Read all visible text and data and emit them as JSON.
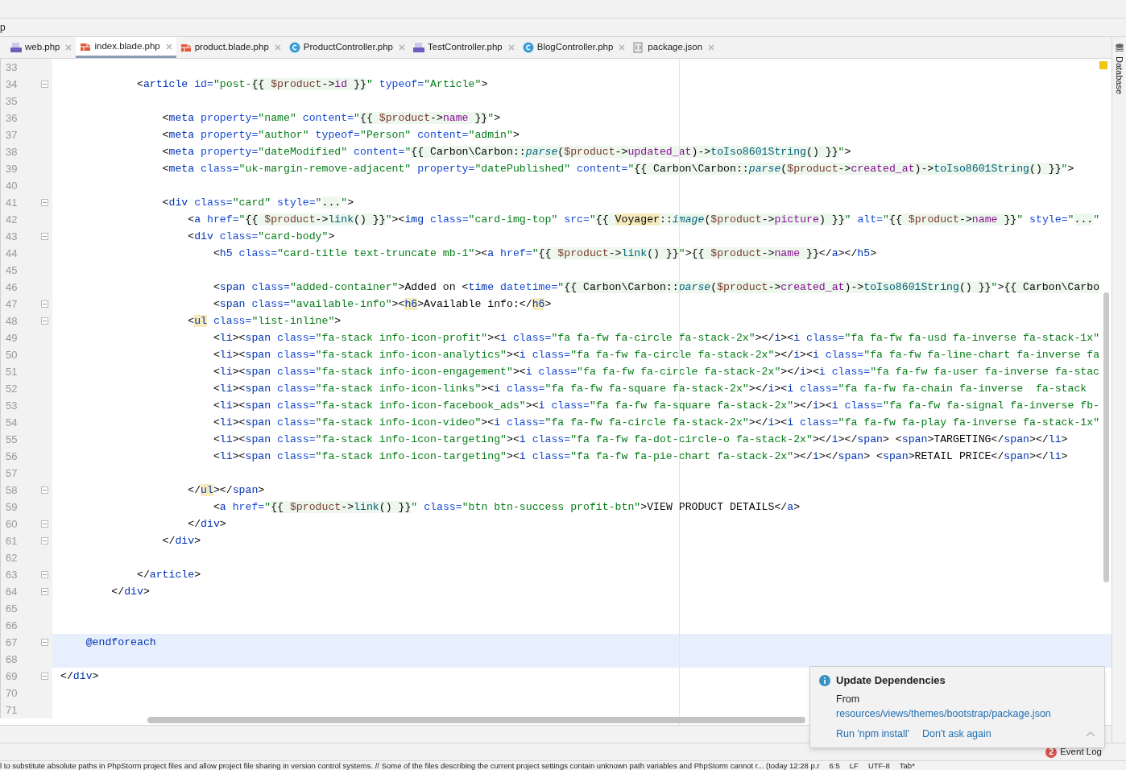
{
  "breadcrumb": "p",
  "tabs": [
    {
      "label": "web.php",
      "kind": "php",
      "selected": false
    },
    {
      "label": "index.blade.php",
      "kind": "blade",
      "selected": true
    },
    {
      "label": "product.blade.php",
      "kind": "blade",
      "selected": false
    },
    {
      "label": "ProductController.php",
      "kind": "class",
      "selected": false
    },
    {
      "label": "TestController.php",
      "kind": "php",
      "selected": false
    },
    {
      "label": "BlogController.php",
      "kind": "class",
      "selected": false
    },
    {
      "label": "package.json",
      "kind": "json",
      "selected": false
    }
  ],
  "side_panel": {
    "label": "Database"
  },
  "editor": {
    "lines": [
      {
        "number": "33",
        "fold": false,
        "current": false
      },
      {
        "number": "34",
        "fold": true,
        "current": false,
        "tokens": [
          {
            "kind": "p",
            "text": "            <"
          },
          {
            "kind": "tag",
            "text": "article"
          },
          {
            "kind": "attr",
            "text": " id="
          },
          {
            "kind": "str",
            "text": "\"post-"
          },
          {
            "kind": "b",
            "text": "{{ "
          },
          {
            "kind": "bv",
            "text": "$product"
          },
          {
            "kind": "b",
            "text": "->"
          },
          {
            "kind": "bp",
            "text": "id"
          },
          {
            "kind": "b",
            "text": " }}"
          },
          {
            "kind": "str",
            "text": "\""
          },
          {
            "kind": "attr",
            "text": " typeof="
          },
          {
            "kind": "str",
            "text": "\"Article\""
          },
          {
            "kind": "p",
            "text": ">"
          }
        ]
      },
      {
        "number": "35",
        "fold": false,
        "current": false
      },
      {
        "number": "36",
        "fold": false,
        "current": false,
        "tokens": [
          {
            "kind": "p",
            "text": "                <"
          },
          {
            "kind": "tag",
            "text": "meta"
          },
          {
            "kind": "attr",
            "text": " property="
          },
          {
            "kind": "str",
            "text": "\"name\""
          },
          {
            "kind": "attr",
            "text": " content="
          },
          {
            "kind": "str",
            "text": "\""
          },
          {
            "kind": "b",
            "text": "{{ "
          },
          {
            "kind": "bv",
            "text": "$product"
          },
          {
            "kind": "b",
            "text": "->"
          },
          {
            "kind": "bp",
            "text": "name"
          },
          {
            "kind": "b",
            "text": " }}"
          },
          {
            "kind": "str",
            "text": "\""
          },
          {
            "kind": "p",
            "text": ">"
          }
        ]
      },
      {
        "number": "37",
        "fold": false,
        "current": false,
        "tokens": [
          {
            "kind": "p",
            "text": "                <"
          },
          {
            "kind": "tag",
            "text": "meta"
          },
          {
            "kind": "attr",
            "text": " property="
          },
          {
            "kind": "str",
            "text": "\"author\""
          },
          {
            "kind": "attr",
            "text": " typeof="
          },
          {
            "kind": "str",
            "text": "\"Person\""
          },
          {
            "kind": "attr",
            "text": " content="
          },
          {
            "kind": "str",
            "text": "\"admin\""
          },
          {
            "kind": "p",
            "text": ">"
          }
        ]
      },
      {
        "number": "38",
        "fold": false,
        "current": false,
        "tokens": [
          {
            "kind": "p",
            "text": "                <"
          },
          {
            "kind": "tag",
            "text": "meta"
          },
          {
            "kind": "attr",
            "text": " property="
          },
          {
            "kind": "str",
            "text": "\"dateModified\""
          },
          {
            "kind": "attr",
            "text": " content="
          },
          {
            "kind": "str",
            "text": "\""
          },
          {
            "kind": "b",
            "text": "{{ Carbon\\Carbon::"
          },
          {
            "kind": "bf",
            "text": "parse"
          },
          {
            "kind": "b",
            "text": "("
          },
          {
            "kind": "bv",
            "text": "$product"
          },
          {
            "kind": "b",
            "text": "->"
          },
          {
            "kind": "bp",
            "text": "updated_at"
          },
          {
            "kind": "b",
            "text": ")->"
          },
          {
            "kind": "bm",
            "text": "toIso8601String"
          },
          {
            "kind": "b",
            "text": "() }}"
          },
          {
            "kind": "str",
            "text": "\""
          },
          {
            "kind": "p",
            "text": ">"
          }
        ]
      },
      {
        "number": "39",
        "fold": false,
        "current": false,
        "tokens": [
          {
            "kind": "p",
            "text": "                <"
          },
          {
            "kind": "tag",
            "text": "meta"
          },
          {
            "kind": "attr",
            "text": " class="
          },
          {
            "kind": "str",
            "text": "\"uk-margin-remove-adjacent\""
          },
          {
            "kind": "attr",
            "text": " property="
          },
          {
            "kind": "str",
            "text": "\"datePublished\""
          },
          {
            "kind": "attr",
            "text": " content="
          },
          {
            "kind": "str",
            "text": "\""
          },
          {
            "kind": "b",
            "text": "{{ Carbon\\Carbon::"
          },
          {
            "kind": "bf",
            "text": "parse"
          },
          {
            "kind": "b",
            "text": "("
          },
          {
            "kind": "bv",
            "text": "$product"
          },
          {
            "kind": "b",
            "text": "->"
          },
          {
            "kind": "bp",
            "text": "created_at"
          },
          {
            "kind": "b",
            "text": ")->"
          },
          {
            "kind": "bm",
            "text": "toIso8601String"
          },
          {
            "kind": "b",
            "text": "() }}"
          },
          {
            "kind": "str",
            "text": "\""
          },
          {
            "kind": "p",
            "text": ">"
          }
        ]
      },
      {
        "number": "40",
        "fold": false,
        "current": false
      },
      {
        "number": "41",
        "fold": true,
        "current": false,
        "tokens": [
          {
            "kind": "p",
            "text": "                <"
          },
          {
            "kind": "tag",
            "text": "div"
          },
          {
            "kind": "attr",
            "text": " class="
          },
          {
            "kind": "str",
            "text": "\"card\""
          },
          {
            "kind": "attr",
            "text": " style="
          },
          {
            "kind": "str",
            "text": "\""
          },
          {
            "kind": "b",
            "text": "..."
          },
          {
            "kind": "str",
            "text": "\""
          },
          {
            "kind": "p",
            "text": ">"
          }
        ]
      },
      {
        "number": "42",
        "fold": false,
        "current": false,
        "tokens": [
          {
            "kind": "p",
            "text": "                    <"
          },
          {
            "kind": "tag",
            "text": "a"
          },
          {
            "kind": "attr",
            "text": " href="
          },
          {
            "kind": "str",
            "text": "\""
          },
          {
            "kind": "b",
            "text": "{{ "
          },
          {
            "kind": "bv",
            "text": "$product"
          },
          {
            "kind": "b",
            "text": "->"
          },
          {
            "kind": "bm",
            "text": "link"
          },
          {
            "kind": "b",
            "text": "() }}"
          },
          {
            "kind": "str",
            "text": "\""
          },
          {
            "kind": "p",
            "text": "><"
          },
          {
            "kind": "tag",
            "text": "img"
          },
          {
            "kind": "attr",
            "text": " class="
          },
          {
            "kind": "str",
            "text": "\"card-img-top\""
          },
          {
            "kind": "attr",
            "text": " src="
          },
          {
            "kind": "str",
            "text": "\""
          },
          {
            "kind": "b",
            "text": "{{ "
          },
          {
            "kind": "bc",
            "text": "Voyager"
          },
          {
            "kind": "b",
            "text": "::"
          },
          {
            "kind": "bf",
            "text": "image"
          },
          {
            "kind": "b",
            "text": "("
          },
          {
            "kind": "bv",
            "text": "$product"
          },
          {
            "kind": "b",
            "text": "->"
          },
          {
            "kind": "bp",
            "text": "picture"
          },
          {
            "kind": "b",
            "text": ") }}"
          },
          {
            "kind": "str",
            "text": "\""
          },
          {
            "kind": "attr",
            "text": " alt="
          },
          {
            "kind": "str",
            "text": "\""
          },
          {
            "kind": "b",
            "text": "{{ "
          },
          {
            "kind": "bv",
            "text": "$product"
          },
          {
            "kind": "b",
            "text": "->"
          },
          {
            "kind": "bp",
            "text": "name"
          },
          {
            "kind": "b",
            "text": " }}"
          },
          {
            "kind": "str",
            "text": "\""
          },
          {
            "kind": "attr",
            "text": " style="
          },
          {
            "kind": "str",
            "text": "\""
          },
          {
            "kind": "b",
            "text": "..."
          },
          {
            "kind": "str",
            "text": "\""
          }
        ]
      },
      {
        "number": "43",
        "fold": true,
        "current": false,
        "tokens": [
          {
            "kind": "p",
            "text": "                    <"
          },
          {
            "kind": "tag",
            "text": "div"
          },
          {
            "kind": "attr",
            "text": " class="
          },
          {
            "kind": "str",
            "text": "\"card-body\""
          },
          {
            "kind": "p",
            "text": ">"
          }
        ]
      },
      {
        "number": "44",
        "fold": false,
        "current": false,
        "tokens": [
          {
            "kind": "p",
            "text": "                        <"
          },
          {
            "kind": "tag",
            "text": "h5"
          },
          {
            "kind": "attr",
            "text": " class="
          },
          {
            "kind": "str",
            "text": "\"card-title text-truncate mb-1\""
          },
          {
            "kind": "p",
            "text": "><"
          },
          {
            "kind": "tag",
            "text": "a"
          },
          {
            "kind": "attr",
            "text": " href="
          },
          {
            "kind": "str",
            "text": "\""
          },
          {
            "kind": "b",
            "text": "{{ "
          },
          {
            "kind": "bv",
            "text": "$product"
          },
          {
            "kind": "b",
            "text": "->"
          },
          {
            "kind": "bm",
            "text": "link"
          },
          {
            "kind": "b",
            "text": "() }}"
          },
          {
            "kind": "str",
            "text": "\""
          },
          {
            "kind": "p",
            "text": ">"
          },
          {
            "kind": "b",
            "text": "{{ "
          },
          {
            "kind": "bv",
            "text": "$product"
          },
          {
            "kind": "b",
            "text": "->"
          },
          {
            "kind": "bp",
            "text": "name"
          },
          {
            "kind": "b",
            "text": " }}"
          },
          {
            "kind": "p",
            "text": "</"
          },
          {
            "kind": "tag",
            "text": "a"
          },
          {
            "kind": "p",
            "text": "></"
          },
          {
            "kind": "tag",
            "text": "h5"
          },
          {
            "kind": "p",
            "text": ">"
          }
        ]
      },
      {
        "number": "45",
        "fold": false,
        "current": false
      },
      {
        "number": "46",
        "fold": false,
        "current": false,
        "tokens": [
          {
            "kind": "p",
            "text": "                        <"
          },
          {
            "kind": "tag",
            "text": "span"
          },
          {
            "kind": "attr",
            "text": " class="
          },
          {
            "kind": "str",
            "text": "\"added-container\""
          },
          {
            "kind": "p",
            "text": ">Added on <"
          },
          {
            "kind": "tag",
            "text": "time"
          },
          {
            "kind": "attr",
            "text": " datetime="
          },
          {
            "kind": "str",
            "text": "\""
          },
          {
            "kind": "b",
            "text": "{{ Carbon\\Carbon::"
          },
          {
            "kind": "bf",
            "text": "parse"
          },
          {
            "kind": "b",
            "text": "("
          },
          {
            "kind": "bv",
            "text": "$product"
          },
          {
            "kind": "b",
            "text": "->"
          },
          {
            "kind": "bp",
            "text": "created_at"
          },
          {
            "kind": "b",
            "text": ")->"
          },
          {
            "kind": "bm",
            "text": "toIso8601String"
          },
          {
            "kind": "b",
            "text": "() }}"
          },
          {
            "kind": "str",
            "text": "\""
          },
          {
            "kind": "p",
            "text": ">"
          },
          {
            "kind": "b",
            "text": "{{ Carbon\\Carbo"
          }
        ]
      },
      {
        "number": "47",
        "fold": true,
        "current": false,
        "tokens": [
          {
            "kind": "p",
            "text": "                        <"
          },
          {
            "kind": "tag",
            "text": "span"
          },
          {
            "kind": "attr",
            "text": " class="
          },
          {
            "kind": "str",
            "text": "\"available-info\""
          },
          {
            "kind": "p",
            "text": "><"
          },
          {
            "kind": "tm",
            "text": "h6"
          },
          {
            "kind": "p",
            "text": ">Available info:</"
          },
          {
            "kind": "tm",
            "text": "h6"
          },
          {
            "kind": "p",
            "text": ">"
          }
        ]
      },
      {
        "number": "48",
        "fold": true,
        "current": false,
        "tokens": [
          {
            "kind": "p",
            "text": "                    <"
          },
          {
            "kind": "tm",
            "text": "ul"
          },
          {
            "kind": "attr",
            "text": " class="
          },
          {
            "kind": "str",
            "text": "\"list-inline\""
          },
          {
            "kind": "p",
            "text": ">"
          }
        ]
      },
      {
        "number": "49",
        "fold": false,
        "current": false,
        "tokens": [
          {
            "kind": "p",
            "text": "                        <"
          },
          {
            "kind": "tag",
            "text": "li"
          },
          {
            "kind": "p",
            "text": "><"
          },
          {
            "kind": "tag",
            "text": "span"
          },
          {
            "kind": "attr",
            "text": " class="
          },
          {
            "kind": "str",
            "text": "\"fa-stack info-icon-profit\""
          },
          {
            "kind": "p",
            "text": "><"
          },
          {
            "kind": "tag",
            "text": "i"
          },
          {
            "kind": "attr",
            "text": " class="
          },
          {
            "kind": "str",
            "text": "\"fa fa-fw fa-circle fa-stack-2x\""
          },
          {
            "kind": "p",
            "text": "></"
          },
          {
            "kind": "tag",
            "text": "i"
          },
          {
            "kind": "p",
            "text": "><"
          },
          {
            "kind": "tag",
            "text": "i"
          },
          {
            "kind": "attr",
            "text": " class="
          },
          {
            "kind": "str",
            "text": "\"fa fa-fw fa-usd fa-inverse fa-stack-1x\""
          }
        ]
      },
      {
        "number": "50",
        "fold": false,
        "current": false,
        "tokens": [
          {
            "kind": "p",
            "text": "                        <"
          },
          {
            "kind": "tag",
            "text": "li"
          },
          {
            "kind": "p",
            "text": "><"
          },
          {
            "kind": "tag",
            "text": "span"
          },
          {
            "kind": "attr",
            "text": " class="
          },
          {
            "kind": "str",
            "text": "\"fa-stack info-icon-analytics\""
          },
          {
            "kind": "p",
            "text": "><"
          },
          {
            "kind": "tag",
            "text": "i"
          },
          {
            "kind": "attr",
            "text": " class="
          },
          {
            "kind": "str",
            "text": "\"fa fa-fw fa-circle fa-stack-2x\""
          },
          {
            "kind": "p",
            "text": "></"
          },
          {
            "kind": "tag",
            "text": "i"
          },
          {
            "kind": "p",
            "text": "><"
          },
          {
            "kind": "tag",
            "text": "i"
          },
          {
            "kind": "attr",
            "text": " class="
          },
          {
            "kind": "str",
            "text": "\"fa fa-fw fa-line-chart fa-inverse fa"
          }
        ]
      },
      {
        "number": "51",
        "fold": false,
        "current": false,
        "tokens": [
          {
            "kind": "p",
            "text": "                        <"
          },
          {
            "kind": "tag",
            "text": "li"
          },
          {
            "kind": "p",
            "text": "><"
          },
          {
            "kind": "tag",
            "text": "span"
          },
          {
            "kind": "attr",
            "text": " class="
          },
          {
            "kind": "str",
            "text": "\"fa-stack info-icon-engagement\""
          },
          {
            "kind": "p",
            "text": "><"
          },
          {
            "kind": "tag",
            "text": "i"
          },
          {
            "kind": "attr",
            "text": " class="
          },
          {
            "kind": "str",
            "text": "\"fa fa-fw fa-circle fa-stack-2x\""
          },
          {
            "kind": "p",
            "text": "></"
          },
          {
            "kind": "tag",
            "text": "i"
          },
          {
            "kind": "p",
            "text": "><"
          },
          {
            "kind": "tag",
            "text": "i"
          },
          {
            "kind": "attr",
            "text": " class="
          },
          {
            "kind": "str",
            "text": "\"fa fa-fw fa-user fa-inverse fa-stac"
          }
        ]
      },
      {
        "number": "52",
        "fold": false,
        "current": false,
        "tokens": [
          {
            "kind": "p",
            "text": "                        <"
          },
          {
            "kind": "tag",
            "text": "li"
          },
          {
            "kind": "p",
            "text": "><"
          },
          {
            "kind": "tag",
            "text": "span"
          },
          {
            "kind": "attr",
            "text": " class="
          },
          {
            "kind": "str",
            "text": "\"fa-stack info-icon-links\""
          },
          {
            "kind": "p",
            "text": "><"
          },
          {
            "kind": "tag",
            "text": "i"
          },
          {
            "kind": "attr",
            "text": " class="
          },
          {
            "kind": "str",
            "text": "\"fa fa-fw fa-square fa-stack-2x\""
          },
          {
            "kind": "p",
            "text": "></"
          },
          {
            "kind": "tag",
            "text": "i"
          },
          {
            "kind": "p",
            "text": "><"
          },
          {
            "kind": "tag",
            "text": "i"
          },
          {
            "kind": "attr",
            "text": " class="
          },
          {
            "kind": "str",
            "text": "\"fa fa-fw fa-chain fa-inverse  fa-stack"
          }
        ]
      },
      {
        "number": "53",
        "fold": false,
        "current": false,
        "tokens": [
          {
            "kind": "p",
            "text": "                        <"
          },
          {
            "kind": "tag",
            "text": "li"
          },
          {
            "kind": "p",
            "text": "><"
          },
          {
            "kind": "tag",
            "text": "span"
          },
          {
            "kind": "attr",
            "text": " class="
          },
          {
            "kind": "str",
            "text": "\"fa-stack info-icon-facebook_ads\""
          },
          {
            "kind": "p",
            "text": "><"
          },
          {
            "kind": "tag",
            "text": "i"
          },
          {
            "kind": "attr",
            "text": " class="
          },
          {
            "kind": "str",
            "text": "\"fa fa-fw fa-square fa-stack-2x\""
          },
          {
            "kind": "p",
            "text": "></"
          },
          {
            "kind": "tag",
            "text": "i"
          },
          {
            "kind": "p",
            "text": "><"
          },
          {
            "kind": "tag",
            "text": "i"
          },
          {
            "kind": "attr",
            "text": " class="
          },
          {
            "kind": "str",
            "text": "\"fa fa-fw fa-signal fa-inverse fb-"
          }
        ]
      },
      {
        "number": "54",
        "fold": false,
        "current": false,
        "tokens": [
          {
            "kind": "p",
            "text": "                        <"
          },
          {
            "kind": "tag",
            "text": "li"
          },
          {
            "kind": "p",
            "text": "><"
          },
          {
            "kind": "tag",
            "text": "span"
          },
          {
            "kind": "attr",
            "text": " class="
          },
          {
            "kind": "str",
            "text": "\"fa-stack info-icon-video\""
          },
          {
            "kind": "p",
            "text": "><"
          },
          {
            "kind": "tag",
            "text": "i"
          },
          {
            "kind": "attr",
            "text": " class="
          },
          {
            "kind": "str",
            "text": "\"fa fa-fw fa-circle fa-stack-2x\""
          },
          {
            "kind": "p",
            "text": "></"
          },
          {
            "kind": "tag",
            "text": "i"
          },
          {
            "kind": "p",
            "text": "><"
          },
          {
            "kind": "tag",
            "text": "i"
          },
          {
            "kind": "attr",
            "text": " class="
          },
          {
            "kind": "str",
            "text": "\"fa fa-fw fa-play fa-inverse fa-stack-1x\""
          }
        ]
      },
      {
        "number": "55",
        "fold": false,
        "current": false,
        "tokens": [
          {
            "kind": "p",
            "text": "                        <"
          },
          {
            "kind": "tag",
            "text": "li"
          },
          {
            "kind": "p",
            "text": "><"
          },
          {
            "kind": "tag",
            "text": "span"
          },
          {
            "kind": "attr",
            "text": " class="
          },
          {
            "kind": "str",
            "text": "\"fa-stack info-icon-targeting\""
          },
          {
            "kind": "p",
            "text": "><"
          },
          {
            "kind": "tag",
            "text": "i"
          },
          {
            "kind": "attr",
            "text": " class="
          },
          {
            "kind": "str",
            "text": "\"fa fa-fw fa-dot-circle-o fa-stack-2x\""
          },
          {
            "kind": "p",
            "text": "></"
          },
          {
            "kind": "tag",
            "text": "i"
          },
          {
            "kind": "p",
            "text": "></"
          },
          {
            "kind": "tag",
            "text": "span"
          },
          {
            "kind": "p",
            "text": "> <"
          },
          {
            "kind": "tag",
            "text": "span"
          },
          {
            "kind": "p",
            "text": ">TARGETING</"
          },
          {
            "kind": "tag",
            "text": "span"
          },
          {
            "kind": "p",
            "text": "></"
          },
          {
            "kind": "tag",
            "text": "li"
          },
          {
            "kind": "p",
            "text": ">"
          }
        ]
      },
      {
        "number": "56",
        "fold": false,
        "current": false,
        "tokens": [
          {
            "kind": "p",
            "text": "                        <"
          },
          {
            "kind": "tag",
            "text": "li"
          },
          {
            "kind": "p",
            "text": "><"
          },
          {
            "kind": "tag",
            "text": "span"
          },
          {
            "kind": "attr",
            "text": " class="
          },
          {
            "kind": "str",
            "text": "\"fa-stack info-icon-targeting\""
          },
          {
            "kind": "p",
            "text": "><"
          },
          {
            "kind": "tag",
            "text": "i"
          },
          {
            "kind": "attr",
            "text": " class="
          },
          {
            "kind": "str",
            "text": "\"fa fa-fw fa-pie-chart fa-stack-2x\""
          },
          {
            "kind": "p",
            "text": "></"
          },
          {
            "kind": "tag",
            "text": "i"
          },
          {
            "kind": "p",
            "text": "></"
          },
          {
            "kind": "tag",
            "text": "span"
          },
          {
            "kind": "p",
            "text": "> <"
          },
          {
            "kind": "tag",
            "text": "span"
          },
          {
            "kind": "p",
            "text": ">RETAIL PRICE</"
          },
          {
            "kind": "tag",
            "text": "span"
          },
          {
            "kind": "p",
            "text": "></"
          },
          {
            "kind": "tag",
            "text": "li"
          },
          {
            "kind": "p",
            "text": ">"
          }
        ]
      },
      {
        "number": "57",
        "fold": false,
        "current": false
      },
      {
        "number": "58",
        "fold": true,
        "current": false,
        "tokens": [
          {
            "kind": "p",
            "text": "                    </"
          },
          {
            "kind": "tm",
            "text": "ul"
          },
          {
            "kind": "p",
            "text": "></"
          },
          {
            "kind": "tag",
            "text": "span"
          },
          {
            "kind": "p",
            "text": ">"
          }
        ]
      },
      {
        "number": "59",
        "fold": false,
        "current": false,
        "tokens": [
          {
            "kind": "p",
            "text": "                        <"
          },
          {
            "kind": "tag",
            "text": "a"
          },
          {
            "kind": "attr",
            "text": " href="
          },
          {
            "kind": "str",
            "text": "\""
          },
          {
            "kind": "b",
            "text": "{{ "
          },
          {
            "kind": "bv",
            "text": "$product"
          },
          {
            "kind": "b",
            "text": "->"
          },
          {
            "kind": "bm",
            "text": "link"
          },
          {
            "kind": "b",
            "text": "() }}"
          },
          {
            "kind": "str",
            "text": "\""
          },
          {
            "kind": "attr",
            "text": " class="
          },
          {
            "kind": "str",
            "text": "\"btn btn-success profit-btn\""
          },
          {
            "kind": "p",
            "text": ">VIEW PRODUCT DETAILS</"
          },
          {
            "kind": "tag",
            "text": "a"
          },
          {
            "kind": "p",
            "text": ">"
          }
        ]
      },
      {
        "number": "60",
        "fold": true,
        "current": false,
        "tokens": [
          {
            "kind": "p",
            "text": "                    </"
          },
          {
            "kind": "tag",
            "text": "div"
          },
          {
            "kind": "p",
            "text": ">"
          }
        ]
      },
      {
        "number": "61",
        "fold": true,
        "current": false,
        "tokens": [
          {
            "kind": "p",
            "text": "                </"
          },
          {
            "kind": "tag",
            "text": "div"
          },
          {
            "kind": "p",
            "text": ">"
          }
        ]
      },
      {
        "number": "62",
        "fold": false,
        "current": false
      },
      {
        "number": "63",
        "fold": true,
        "current": false,
        "tokens": [
          {
            "kind": "p",
            "text": "            </"
          },
          {
            "kind": "tag",
            "text": "article"
          },
          {
            "kind": "p",
            "text": ">"
          }
        ]
      },
      {
        "number": "64",
        "fold": true,
        "current": false,
        "tokens": [
          {
            "kind": "p",
            "text": "        </"
          },
          {
            "kind": "tag",
            "text": "div"
          },
          {
            "kind": "p",
            "text": ">"
          }
        ]
      },
      {
        "number": "65",
        "fold": false,
        "current": false
      },
      {
        "number": "66",
        "fold": false,
        "current": false
      },
      {
        "number": "67",
        "fold": true,
        "current": true,
        "tokens": [
          {
            "kind": "dir",
            "text": "    @endforeach"
          }
        ]
      },
      {
        "number": "68",
        "fold": false,
        "current": true
      },
      {
        "number": "69",
        "fold": true,
        "current": false,
        "tokens": [
          {
            "kind": "p",
            "text": "</"
          },
          {
            "kind": "tag",
            "text": "div"
          },
          {
            "kind": "p",
            "text": ">"
          }
        ]
      },
      {
        "number": "70",
        "fold": false,
        "current": false
      },
      {
        "number": "71",
        "fold": false,
        "current": false
      }
    ]
  },
  "notification": {
    "title": "Update Dependencies",
    "text": "From",
    "link": "resources/views/themes/bootstrap/package.json",
    "actions": [
      "Run 'npm install'",
      "Don't ask again"
    ]
  },
  "event_log": {
    "count": "2",
    "label": "Event Log"
  },
  "status_bar": {
    "message": "l to substitute absolute paths in PhpStorm project files and allow project file sharing in version control systems. // Some of the files describing the current project settings contain unknown path variables and PhpStorm cannot r... (today 12:28 p.r",
    "items": [
      "6:5",
      "LF",
      "UTF-8",
      "Tab*"
    ]
  }
}
